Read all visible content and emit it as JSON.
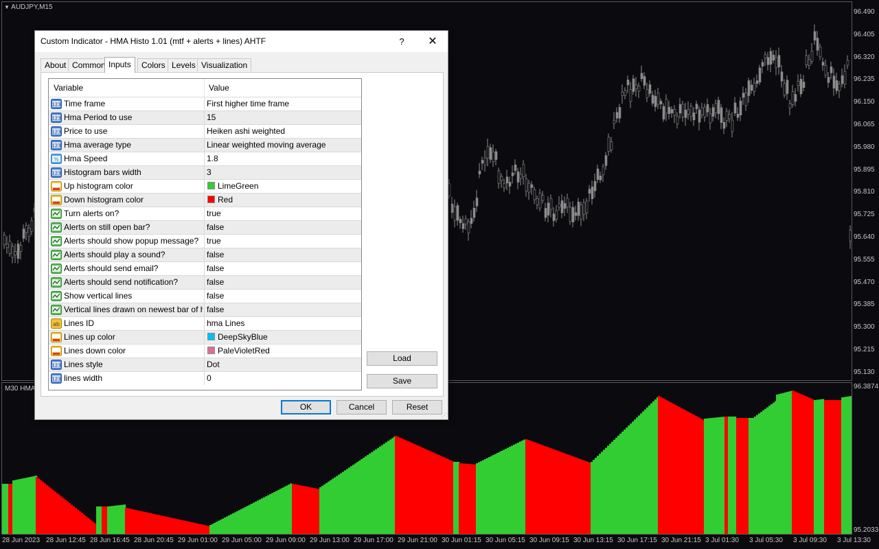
{
  "chart": {
    "symbol_label": "AUDJPY,M15",
    "indicator_label": "M30 HMA",
    "price_ticks": [
      "96.490",
      "96.405",
      "96.320",
      "96.235",
      "96.150",
      "96.065",
      "95.980",
      "95.895",
      "95.810",
      "95.725",
      "95.640",
      "95.555",
      "95.470",
      "95.385",
      "95.300",
      "95.215",
      "95.130"
    ],
    "indicator_ticks": [
      "96.3874",
      "95.2033"
    ],
    "time_ticks": [
      "28 Jun 2023",
      "28 Jun 12:45",
      "28 Jun 16:45",
      "28 Jun 20:45",
      "29 Jun 01:00",
      "29 Jun 05:00",
      "29 Jun 09:00",
      "29 Jun 13:00",
      "29 Jun 17:00",
      "29 Jun 21:00",
      "30 Jun 01:15",
      "30 Jun 05:15",
      "30 Jun 09:15",
      "30 Jun 13:15",
      "30 Jun 17:15",
      "30 Jun 21:15",
      "3 Jul 01:30",
      "3 Jul 05:30",
      "3 Jul 09:30",
      "3 Jul 13:30"
    ],
    "colors": {
      "background": "#0b0b0f",
      "candle": "#8c8c8c",
      "up_histogram": "#32cd32",
      "down_histogram": "#ff0000"
    }
  },
  "dialog": {
    "title": "Custom Indicator - HMA Histo 1.01 (mtf + alerts + lines) AHTF",
    "help_label": "?",
    "close_label": "✕",
    "tabs": [
      {
        "label": "About"
      },
      {
        "label": "Common"
      },
      {
        "label": "Inputs",
        "active": true
      },
      {
        "label": "Colors"
      },
      {
        "label": "Levels"
      },
      {
        "label": "Visualization"
      }
    ],
    "grid": {
      "col_variable": "Variable",
      "col_value": "Value",
      "rows": [
        {
          "icon": "int",
          "variable": "Time frame",
          "value": "First higher time frame"
        },
        {
          "icon": "int",
          "variable": "Hma Period to use",
          "value": "15"
        },
        {
          "icon": "int",
          "variable": "Price to use",
          "value": "Heiken ashi weighted"
        },
        {
          "icon": "int",
          "variable": "Hma average type",
          "value": "Linear weighted moving average"
        },
        {
          "icon": "double",
          "variable": "Hma Speed",
          "value": "1.8"
        },
        {
          "icon": "int",
          "variable": "Histogram bars width",
          "value": "3"
        },
        {
          "icon": "color",
          "variable": "Up histogram color",
          "value": "LimeGreen",
          "swatch": "#32cd32"
        },
        {
          "icon": "color",
          "variable": "Down histogram color",
          "value": "Red",
          "swatch": "#ff0000"
        },
        {
          "icon": "bool",
          "variable": "Turn alerts on?",
          "value": "true"
        },
        {
          "icon": "bool",
          "variable": "Alerts on still open bar?",
          "value": "false"
        },
        {
          "icon": "bool",
          "variable": "Alerts should show popup message?",
          "value": "true"
        },
        {
          "icon": "bool",
          "variable": "Alerts should play a sound?",
          "value": "false"
        },
        {
          "icon": "bool",
          "variable": "Alerts should send email?",
          "value": "false"
        },
        {
          "icon": "bool",
          "variable": "Alerts should send notification?",
          "value": "false"
        },
        {
          "icon": "bool",
          "variable": "Show vertical lines",
          "value": "false"
        },
        {
          "icon": "bool",
          "variable": "Vertical lines drawn on newest bar of hig...",
          "value": "false"
        },
        {
          "icon": "string",
          "variable": "Lines ID",
          "value": "hma Lines"
        },
        {
          "icon": "color",
          "variable": "Lines up color",
          "value": "DeepSkyBlue",
          "swatch": "#00bfff"
        },
        {
          "icon": "color",
          "variable": "Lines down color",
          "value": "PaleVioletRed",
          "swatch": "#db7093"
        },
        {
          "icon": "int",
          "variable": "Lines style",
          "value": "Dot"
        },
        {
          "icon": "int",
          "variable": "lines width",
          "value": "0"
        }
      ]
    },
    "buttons": {
      "load": "Load",
      "save": "Save",
      "ok": "OK",
      "cancel": "Cancel",
      "reset": "Reset"
    }
  }
}
